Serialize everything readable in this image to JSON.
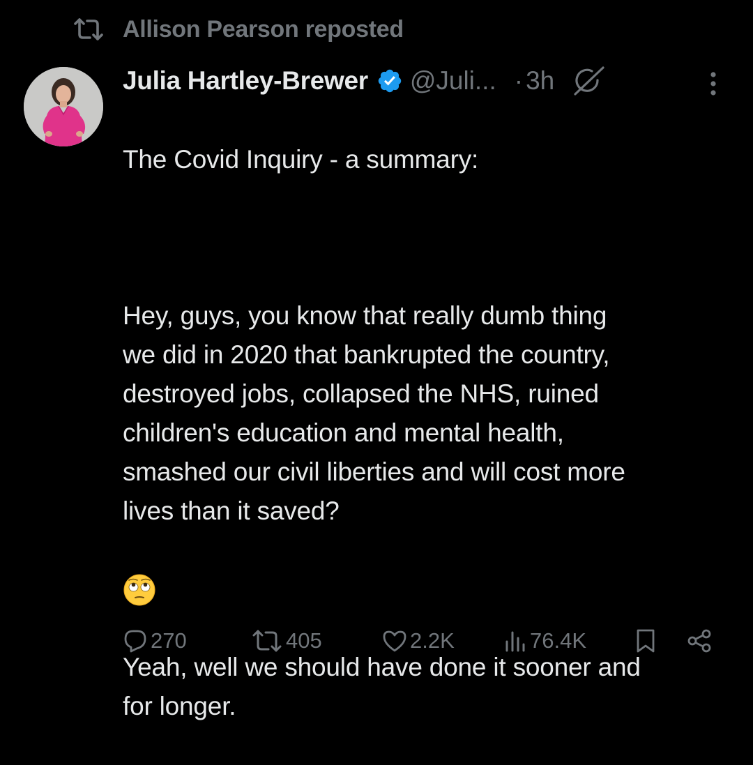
{
  "repost": {
    "label": "Allison Pearson reposted",
    "icon": "repost-icon"
  },
  "author": {
    "display_name": "Julia Hartley-Brewer",
    "handle": "@Juli...",
    "verified": true,
    "verified_color": "#1d9bf0"
  },
  "meta": {
    "separator": "·",
    "timestamp": "3h"
  },
  "tweet": {
    "line_1": "The Covid Inquiry - a summary:",
    "paragraph_2": "Hey, guys, you know that really dumb thing\nwe did in 2020 that bankrupted the country,\ndestroyed jobs, collapsed the NHS, ruined\nchildren's education and mental health,\nsmashed our civil liberties and will cost more\nlives than it saved?",
    "paragraph_3": "Yeah, well we should have done it sooner and\nfor longer.",
    "emoji": "🙄"
  },
  "actions": {
    "replies": "270",
    "reposts": "405",
    "likes": "2.2K",
    "views": "76.4K"
  },
  "colors": {
    "background": "#000000",
    "primary_text": "#e7e9ea",
    "secondary_text": "#71767b",
    "accent": "#1d9bf0"
  }
}
